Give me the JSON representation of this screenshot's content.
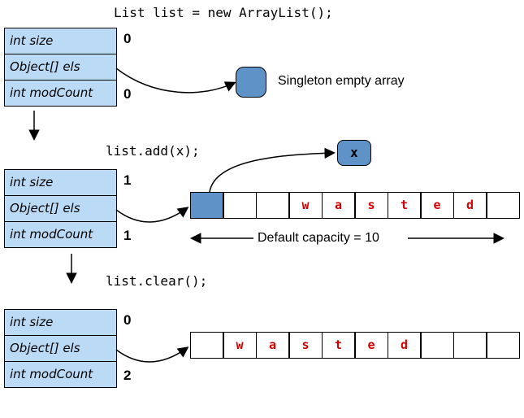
{
  "code": {
    "line1": "List list = new ArrayList();",
    "line2": "list.add(x);",
    "line3": "list.clear();"
  },
  "struct_fields": {
    "f1": "int size",
    "f2": "Object[] els",
    "f3": "int modCount"
  },
  "values": {
    "s1_size": "0",
    "s1_mod": "0",
    "s2_size": "1",
    "s2_mod": "1",
    "s3_size": "0",
    "s3_mod": "2"
  },
  "annotations": {
    "singleton": "Singleton empty array",
    "xlabel": "x",
    "capacity": "Default capacity = 10"
  },
  "wasted1": [
    "",
    "",
    "w",
    "a",
    "s",
    "t",
    "e",
    "d",
    ""
  ],
  "wasted2": [
    "",
    "w",
    "a",
    "s",
    "t",
    "e",
    "d",
    "",
    "",
    ""
  ]
}
